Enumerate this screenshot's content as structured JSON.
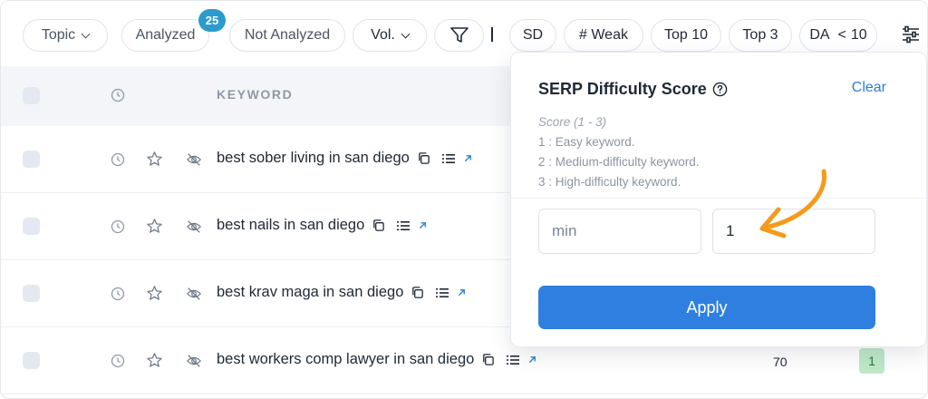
{
  "toolbar": {
    "topic": "Topic",
    "analyzed": "Analyzed",
    "analyzed_count": "25",
    "not_analyzed": "Not Analyzed",
    "vol": "Vol.",
    "separator": "|",
    "sd": "SD",
    "weak": "# Weak",
    "top10": "Top 10",
    "top3": "Top 3",
    "da": "DA",
    "da_op": "<",
    "da_value": "10"
  },
  "table": {
    "header": {
      "keyword": "KEYWORD"
    },
    "rows": [
      {
        "keyword": "best sober living in san diego",
        "volume": "",
        "sd": ""
      },
      {
        "keyword": "best nails in san diego",
        "volume": "",
        "sd": ""
      },
      {
        "keyword": "best krav maga in san diego",
        "volume": "",
        "sd": ""
      },
      {
        "keyword": "best workers comp lawyer in san diego",
        "volume": "70",
        "sd": "1"
      }
    ]
  },
  "popover": {
    "title": "SERP Difficulty Score",
    "clear_label": "Clear",
    "desc_line1": "Score (1 - 3)",
    "desc_line2": "1 : Easy keyword.",
    "desc_line3": "2 : Medium-difficulty keyword.",
    "desc_line4": "3 : High-difficulty keyword.",
    "min_placeholder": "min",
    "max_value": "1",
    "apply_label": "Apply"
  },
  "colors": {
    "accent": "#2f7fe0",
    "badge": "#2b9bcc",
    "arrow": "#f59a1b",
    "sd_easy_bg": "#bfe8c8"
  },
  "icons": [
    "chevron-down-icon",
    "filter-icon",
    "settings-sliders-icon",
    "history-icon",
    "star-icon",
    "eye-off-icon",
    "copy-icon",
    "list-icon",
    "external-link-icon",
    "help-circle-icon"
  ]
}
